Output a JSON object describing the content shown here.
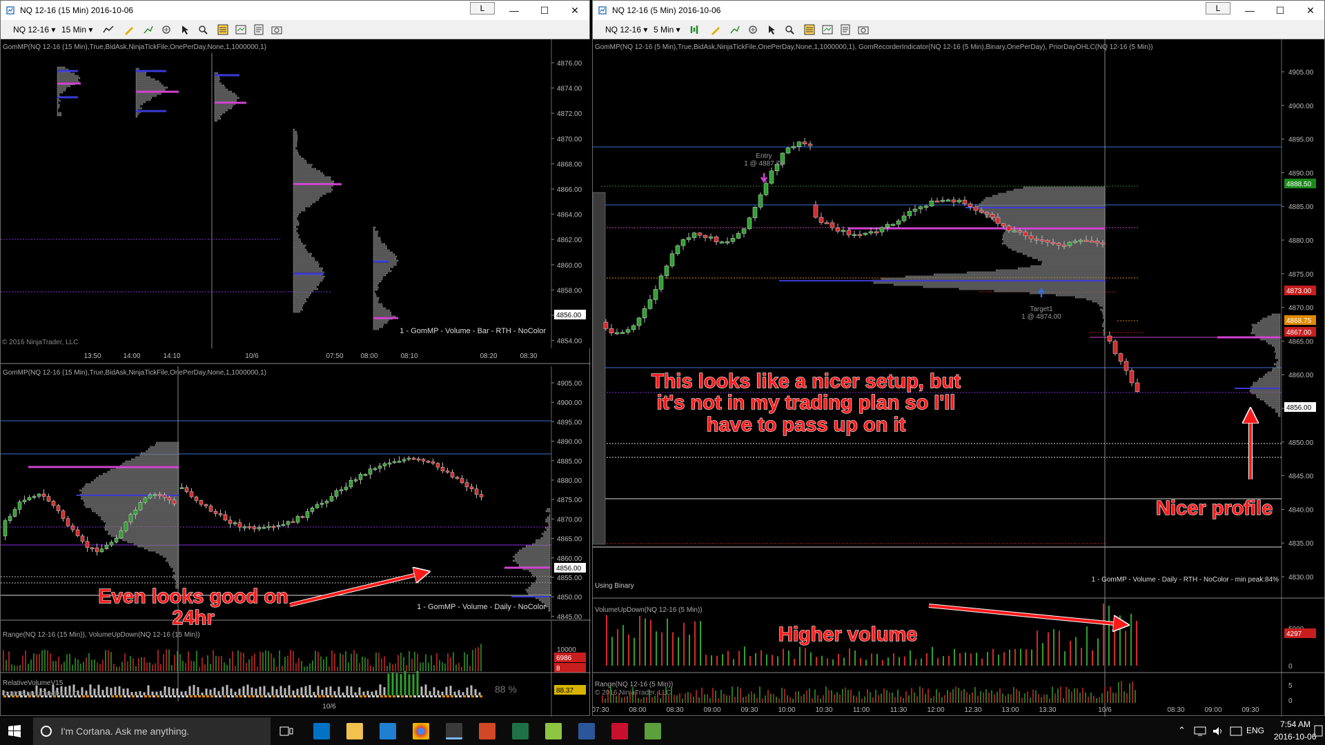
{
  "window_left": {
    "title": "NQ 12-16 (15 Min)  2016-10-06",
    "l_button": "L",
    "instrument": "NQ 12-16",
    "interval": "15 Min",
    "top_indicator": "GomMP(NQ 12-16 (15 Min),True,BidAsk,NinjaTickFile,OnePerDay,None,1,1000000,1)",
    "top_footer": "1 - GomMP  - Volume - Bar - RTH - NoColor",
    "top_copyright": "© 2016 NinjaTrader, LLC",
    "top_price_axis": [
      "4876.00",
      "4874.00",
      "4872.00",
      "4870.00",
      "4868.00",
      "4866.00",
      "4864.00",
      "4862.00",
      "4860.00",
      "4858.00",
      "4856.00",
      "4854.00"
    ],
    "top_price_highlight": "4856.00",
    "top_time_axis": [
      "13:50",
      "14:00",
      "14:10",
      "10/6",
      "07:50",
      "08:00",
      "08:10",
      "08:20",
      "08:30"
    ],
    "bottom_indicator": "GomMP(NQ 12-16 (15 Min),True,BidAsk,NinjaTickFile,OnePerDay,None,1,1000000,1)",
    "bottom_footer": "1 - GomMP  - Volume - Daily - NoColor",
    "bottom_price_axis": [
      "4905.00",
      "4900.00",
      "4895.00",
      "4890.00",
      "4885.00",
      "4880.00",
      "4875.00",
      "4870.00",
      "4865.00",
      "4860.00",
      "4855.00",
      "4850.00",
      "4845.00"
    ],
    "bottom_price_highlight": "4856.00",
    "range_indicator": "Range(NQ 12-16 (15 Min)), VolumeUpDown(NQ 12-16 (15 Min))",
    "range_axis_10000": "10000",
    "range_value": "6986",
    "range_value2": "8",
    "rel_volume_label": "RelativeVolumeV15",
    "rel_volume_pct": "88 %",
    "rel_volume_value": "88.37",
    "bottom_copyright": "© 2016 NinjaTrader, LLC",
    "bottom_time_label": "10/6"
  },
  "window_right": {
    "title": "NQ 12-16 (5 Min)  2016-10-06",
    "l_button": "L",
    "instrument": "NQ 12-16",
    "interval": "5 Min",
    "indicator": "GomMP(NQ 12-16 (5 Min),True,BidAsk,NinjaTickFile,OnePerDay,None,1,1000000,1), GomRecorderIndicator(NQ 12-16 (5 Min),Binary,OnePerDay), PriorDayOHLC(NQ 12-16 (5 Min))",
    "entry_label": "Entry",
    "entry_detail": "1 @ 4887.75",
    "target_label": "Target1",
    "target_detail": "1 @ 4874.00",
    "using_binary": "Using Binary",
    "footer": "1 - GomMP  - Volume - Daily - RTH - NoColor - min peak:84%",
    "price_axis": [
      "4905.00",
      "4900.00",
      "4895.00",
      "4890.00",
      "4885.00",
      "4880.00",
      "4875.00",
      "4870.00",
      "4865.00",
      "4860.00",
      "4855.00",
      "4850.00",
      "4845.00",
      "4840.00",
      "4835.00",
      "4830.00"
    ],
    "price_tags": [
      {
        "text": "4888.50",
        "color": "#1a8a1a"
      },
      {
        "text": "4873.00",
        "color": "#c81e1e"
      },
      {
        "text": "4868.75",
        "color": "#e08a00"
      },
      {
        "text": "4867.00",
        "color": "#c81e1e"
      },
      {
        "text": "4856.00",
        "color": "#ffffff"
      }
    ],
    "volume_label": "VolumeUpDown(NQ 12-16 (5 Min))",
    "volume_axis": "5000",
    "volume_value": "4297",
    "volume_zero": "0",
    "range_label": "Range(NQ 12-16 (5 Min))",
    "range_copyright": "© 2016 NinjaTrader, LLC",
    "range_axis": "5",
    "range_zero": "0",
    "time_axis": [
      "07:30",
      "08:00",
      "08:30",
      "09:00",
      "09:30",
      "10:00",
      "10:30",
      "11:00",
      "11:30",
      "12:00",
      "12:30",
      "13:00",
      "13:30",
      "10/6",
      "08:30",
      "09:00",
      "09:30"
    ]
  },
  "annotations": {
    "setup_note": [
      "This looks like a nicer setup, but",
      "it's not in my trading plan so I'll",
      "have to pass up on it"
    ],
    "good_24hr": [
      "Even looks good on",
      "24hr"
    ],
    "higher_volume": "Higher volume",
    "nicer_profile": "Nicer profile"
  },
  "taskbar": {
    "search_placeholder": "I'm Cortana. Ask me anything.",
    "language": "ENG",
    "time": "7:54 AM",
    "date": "2016-10-06"
  },
  "colors": {
    "up_candle": "#2ea12e",
    "down_candle": "#d42a2a",
    "profile_fill": "#4a4a4a",
    "poc_magenta": "#d243d2",
    "value_area_blue": "#3a3ad8",
    "annotation_red": "#ff1a1a"
  }
}
